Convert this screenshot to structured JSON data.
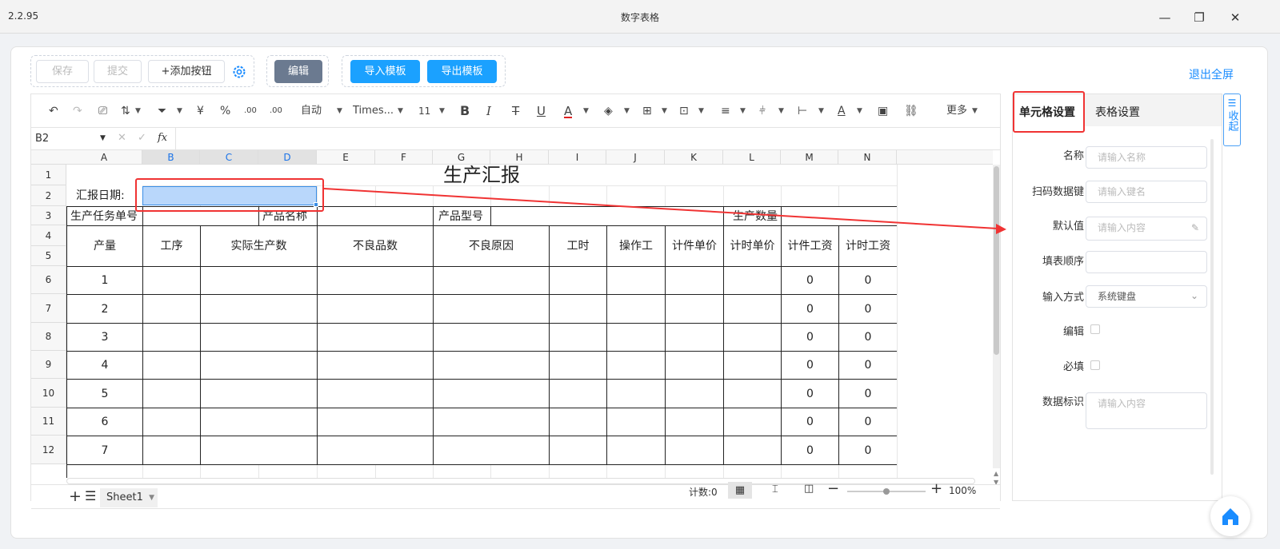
{
  "window": {
    "version": "2.2.95",
    "title": "数字表格"
  },
  "actions": {
    "save": "保存",
    "submit": "提交",
    "add_button": "+添加按钮",
    "edit": "编辑",
    "import_template": "导入模板",
    "export_template": "导出模板",
    "exit_fullscreen": "退出全屏"
  },
  "toolbar": {
    "auto": "自动",
    "font": "Times...",
    "size": "11",
    "currency": "¥",
    "percent": "%",
    "more": "更多",
    "bold": "B",
    "italic": "I",
    "strike": "T",
    "underline": "U",
    "font_color": "A",
    "font_color_accent": "#e02020"
  },
  "formula_bar": {
    "cell_ref": "B2",
    "fx": "fx"
  },
  "columns": [
    "A",
    "B",
    "C",
    "D",
    "E",
    "F",
    "G",
    "H",
    "I",
    "J",
    "K",
    "L",
    "M",
    "N"
  ],
  "rows": [
    "1",
    "2",
    "3",
    "4",
    "5",
    "6",
    "7",
    "8",
    "9",
    "10",
    "11",
    "12"
  ],
  "sheet": {
    "title": "生产汇报",
    "report_date_label": "汇报日期:",
    "task_no_label": "生产任务单号",
    "product_name_label": "产品名称",
    "product_model_label": "产品型号",
    "production_qty_label": "生产数量",
    "headers": [
      "产量",
      "工序",
      "实际生产数",
      "不良品数",
      "不良原因",
      "工时",
      "操作工",
      "计件单价",
      "计时单价",
      "计件工资",
      "计时工资"
    ],
    "row_numbers": [
      "1",
      "2",
      "3",
      "4",
      "5",
      "6",
      "7"
    ],
    "piece_wage": [
      "0",
      "0",
      "0",
      "0",
      "0",
      "0",
      "0"
    ],
    "time_wage": [
      "0",
      "0",
      "0",
      "0",
      "0",
      "0",
      "0"
    ]
  },
  "tabs": {
    "sheet1": "Sheet1"
  },
  "status": {
    "count": "计数:0",
    "zoom": "100%",
    "zoom_level": 0.5
  },
  "panel": {
    "tab_cell": "单元格设置",
    "tab_table": "表格设置",
    "collapse": "收起",
    "fields": {
      "name_label": "名称",
      "name_placeholder": "请输入名称",
      "scan_key_label": "扫码数据键",
      "scan_key_placeholder": "请输入键名",
      "default_label": "默认值",
      "default_placeholder": "请输入内容",
      "order_label": "填表顺序",
      "input_mode_label": "输入方式",
      "input_mode_value": "系统键盘",
      "editable_label": "编辑",
      "required_label": "必填",
      "data_tag_label": "数据标识",
      "data_tag_placeholder": "请输入内容"
    }
  }
}
